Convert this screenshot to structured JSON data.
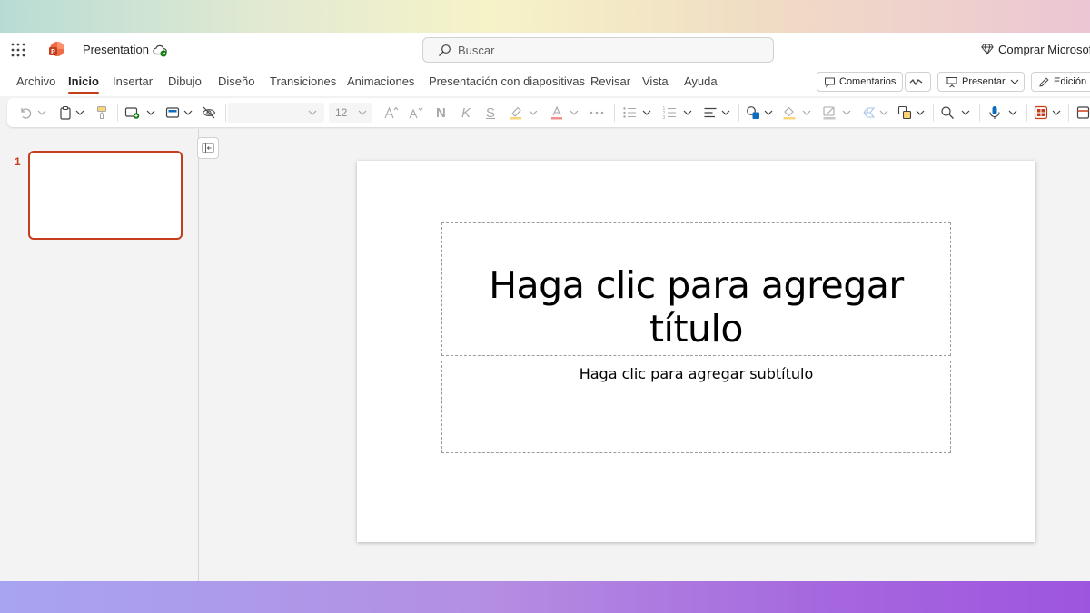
{
  "app": {
    "document_title": "Presentation",
    "search_placeholder": "Buscar",
    "buy_label": "Comprar Microsoft",
    "accent_color": "#c43e1c"
  },
  "menu": {
    "items": [
      "Archivo",
      "Inicio",
      "Insertar",
      "Dibujo",
      "Diseño",
      "Transiciones",
      "Animaciones",
      "Presentación con diapositivas",
      "Revisar",
      "Vista",
      "Ayuda"
    ],
    "active": "Inicio",
    "comments_label": "Comentarios",
    "present_label": "Presentar",
    "editing_label": "Edición"
  },
  "ribbon": {
    "font_size": "12",
    "icons": [
      "undo-icon",
      "clipboard-icon",
      "format-painter-icon",
      "new-slide-icon",
      "layout-icon",
      "hide-slide-icon",
      "font-grow-icon",
      "font-shrink-icon",
      "bold-icon",
      "italic-icon",
      "underline-icon",
      "highlight-icon",
      "font-color-icon",
      "more-icon",
      "bullets-icon",
      "numbering-icon",
      "align-icon",
      "shapes-icon",
      "shape-fill-icon",
      "shape-outline-icon",
      "shape-effects-icon",
      "arrange-icon",
      "find-icon",
      "dictate-icon",
      "designer-icon"
    ],
    "bold_glyph": "N",
    "italic_glyph": "K",
    "underline_glyph": "S"
  },
  "slides_pane": {
    "slide_numbers": [
      "1"
    ]
  },
  "slide": {
    "title_placeholder": "Haga clic para agregar título",
    "subtitle_placeholder": "Haga clic para agregar subtítulo"
  }
}
